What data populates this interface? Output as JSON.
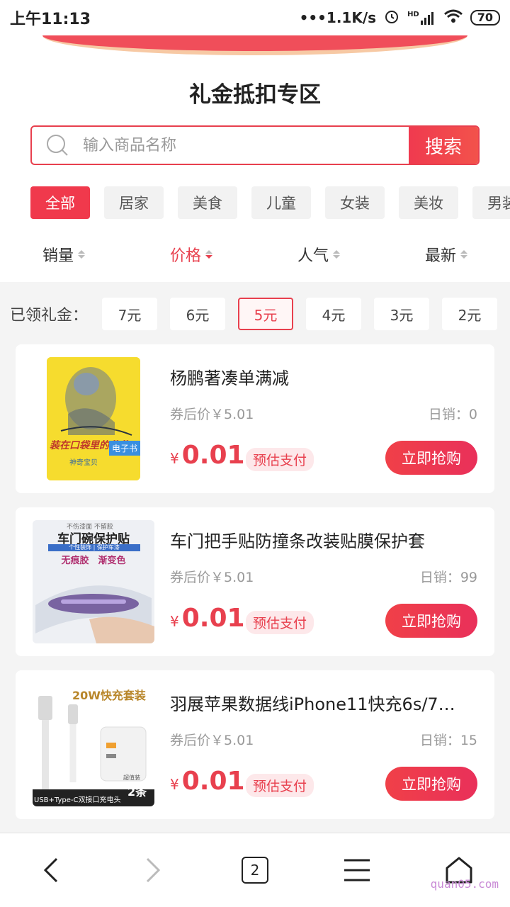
{
  "status": {
    "time": "上午11:13",
    "speed": "•••1.1K/s",
    "signal": "HD",
    "battery": "70"
  },
  "header": {
    "title": "礼金抵扣专区"
  },
  "search": {
    "placeholder": "输入商品名称",
    "button": "搜索"
  },
  "categories": [
    "全部",
    "居家",
    "美食",
    "儿童",
    "女装",
    "美妆",
    "男装"
  ],
  "sort": [
    "销量",
    "价格",
    "人气",
    "最新"
  ],
  "gift": {
    "label": "已领礼金：",
    "chips": [
      "7元",
      "6元",
      "5元",
      "4元",
      "3元",
      "2元"
    ]
  },
  "products": [
    {
      "title": "杨鹏著凑单满减",
      "orig": "券后价￥5.01",
      "daily": "日销：0",
      "yen": "¥",
      "price": "0.01",
      "tag": "预估支付",
      "buy": "立即抢购",
      "book_title": "装在口袋里的爸爸",
      "book_badge": "电子书",
      "book_sub": "神奇宝贝"
    },
    {
      "title": "车门把手贴防撞条改装贴膜保护套",
      "orig": "券后价￥5.01",
      "daily": "日销：99",
      "yen": "¥",
      "price": "0.01",
      "tag": "预估支付",
      "buy": "立即抢购",
      "img_top": "不伤漆面 不留胶",
      "img_heading": "车门碗保护贴",
      "img_ribbon": "个性装饰 | 保护车漆",
      "img_sub": "无痕胶　渐变色"
    },
    {
      "title": "羽展苹果数据线iPhone11快充6s/7…",
      "orig": "券后价￥5.01",
      "daily": "日销：15",
      "yen": "¥",
      "price": "0.01",
      "tag": "预估支付",
      "buy": "立即抢购",
      "img_top": "20W快充套装",
      "img_bottom": "USB+Type-C双接口充电头",
      "img_badge": "2条",
      "img_badge_small": "超值装"
    }
  ],
  "bottom": {
    "tabs": "2"
  },
  "watermark": "quan05.com"
}
